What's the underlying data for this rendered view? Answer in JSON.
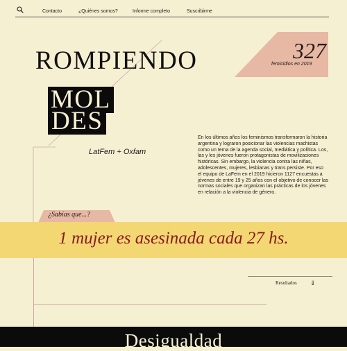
{
  "nav": {
    "items": [
      {
        "label": "Contacto"
      },
      {
        "label": "¿Quiénes somos?"
      },
      {
        "label": "Informe completo"
      },
      {
        "label": "Suscribirme"
      }
    ]
  },
  "headline": {
    "line1": "ROMPIENDO",
    "line2": "MOL",
    "line3": "DES"
  },
  "byline": "LatFem + Oxfam",
  "stat": {
    "number": "327",
    "caption": "femicidios en 2019",
    "color": "#e7b8a3"
  },
  "intro": "En los últimos años los feminismos transformaron la historia argentina y lograron posicionar las violencias machistas como un tema de la agenda social, mediática y política. Los, las y les jóvenes fueron protagonistas de movilizaciones históricas. Sin embargo, la violencia contra las niñas, adolescentes, mujeres, lesbianas y trans persiste. Por eso el equipo de LaFem en el 2019 hicieron 1127 encuestas a jóvenes de entre 19 y 25 años con el objetivo de conocer las normas sociales que organizan las prácticas de los jóvenes en relación a la violencia de género.",
  "fact": {
    "label": "¿Sabías que...?",
    "text": "1 mujer es asesinada cada 27 hs.",
    "banner_color": "#f2d773",
    "text_color": "#8a1a22"
  },
  "results": {
    "label": "Resultados",
    "mark": "⇓"
  },
  "footer": {
    "title": "Desigualdad"
  }
}
